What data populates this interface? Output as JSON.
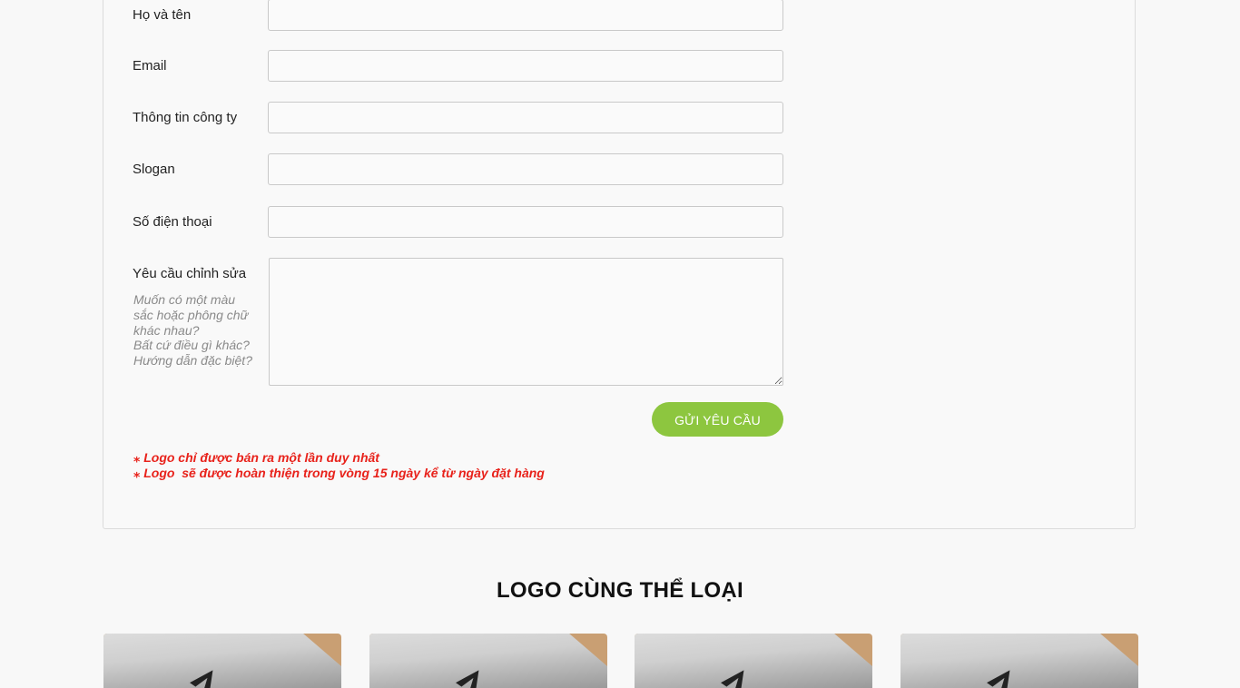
{
  "form": {
    "fields": [
      {
        "label": "Họ và tên",
        "value": ""
      },
      {
        "label": "Email",
        "value": ""
      },
      {
        "label": "Thông tin công ty",
        "value": ""
      },
      {
        "label": "Slogan",
        "value": ""
      },
      {
        "label": "Số điện thoại",
        "value": ""
      }
    ],
    "request": {
      "label": "Yêu cầu chỉnh sửa",
      "hint_lines": [
        "Muốn có một màu",
        "sắc hoặc phông chữ",
        "khác nhau?",
        "Bất cứ điều gì khác?",
        "Hướng dẫn đặc biệt?"
      ],
      "value": ""
    },
    "submit_label": "GỬI YÊU CẦU",
    "notes": [
      "⁎ Logo chỉ được bán ra một lần duy nhất",
      "⁎ Logo  sẽ được hoàn thiện trong vòng 15 ngày kể từ ngày đặt hàng"
    ]
  },
  "related": {
    "title": "LOGO CÙNG THỂ LOẠI",
    "cards": [
      "logo-card-1",
      "logo-card-2",
      "logo-card-3",
      "logo-card-4"
    ]
  },
  "colors": {
    "accent": "#8dc63f",
    "warning": "#e8221b"
  }
}
